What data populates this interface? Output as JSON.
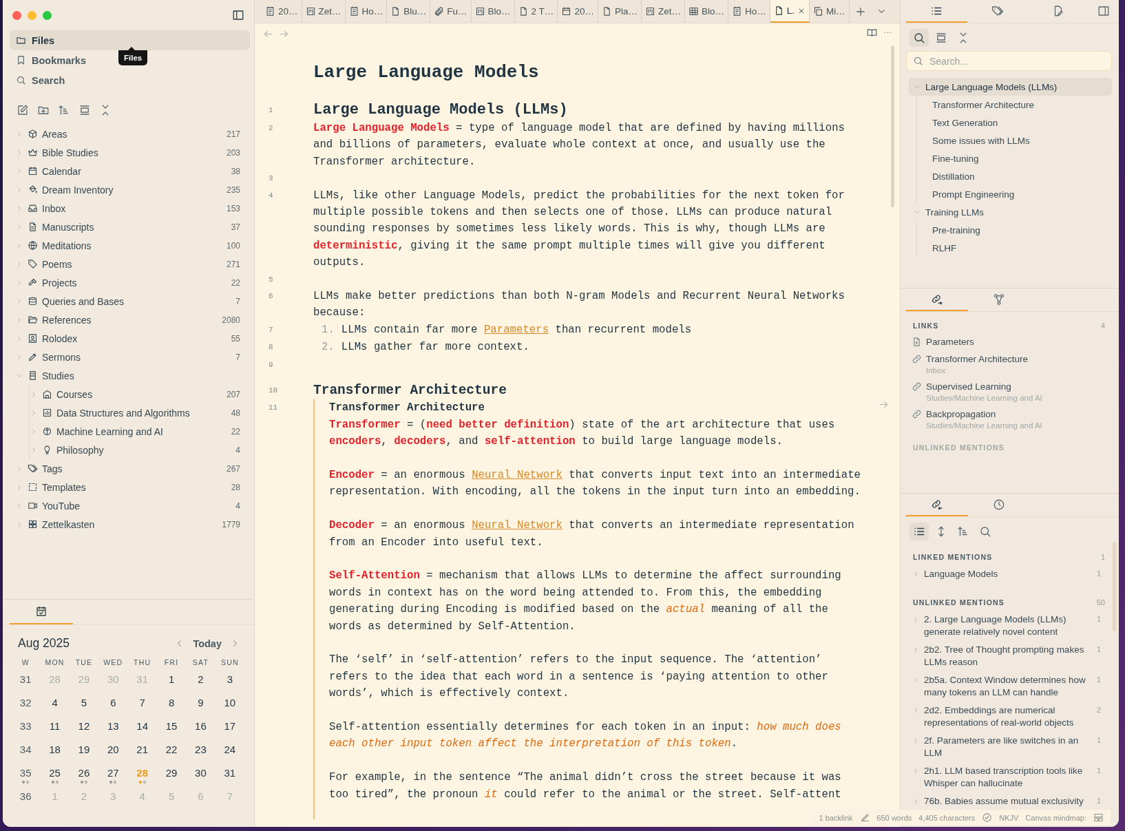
{
  "left_sidebar": {
    "nav": [
      {
        "label": "Files",
        "selected": true
      },
      {
        "label": "Bookmarks",
        "selected": false
      },
      {
        "label": "Search",
        "selected": false
      }
    ],
    "tooltip": "Files",
    "tree": [
      {
        "label": "Areas",
        "count": "217",
        "expanded": false
      },
      {
        "label": "Bible Studies",
        "count": "203",
        "expanded": false
      },
      {
        "label": "Calendar",
        "count": "38",
        "expanded": false
      },
      {
        "label": "Dream Inventory",
        "count": "235",
        "expanded": false
      },
      {
        "label": "Inbox",
        "count": "153",
        "expanded": false
      },
      {
        "label": "Manuscripts",
        "count": "37",
        "expanded": false
      },
      {
        "label": "Meditations",
        "count": "100",
        "expanded": false
      },
      {
        "label": "Poems",
        "count": "271",
        "expanded": false
      },
      {
        "label": "Projects",
        "count": "22",
        "expanded": false
      },
      {
        "label": "Queries and Bases",
        "count": "7",
        "expanded": false
      },
      {
        "label": "References",
        "count": "2080",
        "expanded": false
      },
      {
        "label": "Rolodex",
        "count": "55",
        "expanded": false
      },
      {
        "label": "Sermons",
        "count": "7",
        "expanded": false
      },
      {
        "label": "Studies",
        "expanded": true,
        "children": [
          {
            "label": "Courses",
            "count": "207",
            "expanded": false
          },
          {
            "label": "Data Structures and Algorithms",
            "count": "48",
            "expanded": false
          },
          {
            "label": "Machine Learning and AI",
            "count": "22",
            "expanded": false
          },
          {
            "label": "Philosophy",
            "count": "4",
            "expanded": false
          }
        ]
      },
      {
        "label": "Tags",
        "count": "267",
        "expanded": false
      },
      {
        "label": "Templates",
        "count": "28",
        "expanded": false
      },
      {
        "label": "YouTube",
        "count": "4",
        "expanded": false
      },
      {
        "label": "Zettelkasten",
        "count": "1779",
        "expanded": false
      }
    ],
    "calendar": {
      "month": "Aug 2025",
      "today_button": "Today",
      "weekdays": [
        "W",
        "MON",
        "TUE",
        "WED",
        "THU",
        "FRI",
        "SAT",
        "SUN"
      ],
      "weeks": [
        {
          "week": "31",
          "dots": false,
          "days": [
            {
              "label": "28",
              "outside": true,
              "today": false,
              "dots": false
            },
            {
              "label": "29",
              "outside": true,
              "today": false,
              "dots": false
            },
            {
              "label": "30",
              "outside": true,
              "today": false,
              "dots": false
            },
            {
              "label": "31",
              "outside": true,
              "today": false,
              "dots": false
            },
            {
              "label": "1",
              "outside": false,
              "today": false,
              "dots": false
            },
            {
              "label": "2",
              "outside": false,
              "today": false,
              "dots": false
            },
            {
              "label": "3",
              "outside": false,
              "today": false,
              "dots": false
            }
          ]
        },
        {
          "week": "32",
          "dots": false,
          "days": [
            {
              "label": "4",
              "outside": false,
              "today": false,
              "dots": false
            },
            {
              "label": "5",
              "outside": false,
              "today": false,
              "dots": false
            },
            {
              "label": "6",
              "outside": false,
              "today": false,
              "dots": false
            },
            {
              "label": "7",
              "outside": false,
              "today": false,
              "dots": false
            },
            {
              "label": "8",
              "outside": false,
              "today": false,
              "dots": false
            },
            {
              "label": "9",
              "outside": false,
              "today": false,
              "dots": false
            },
            {
              "label": "10",
              "outside": false,
              "today": false,
              "dots": false
            }
          ]
        },
        {
          "week": "33",
          "dots": false,
          "days": [
            {
              "label": "11",
              "outside": false,
              "today": false,
              "dots": false
            },
            {
              "label": "12",
              "outside": false,
              "today": false,
              "dots": false
            },
            {
              "label": "13",
              "outside": false,
              "today": false,
              "dots": false
            },
            {
              "label": "14",
              "outside": false,
              "today": false,
              "dots": false
            },
            {
              "label": "15",
              "outside": false,
              "today": false,
              "dots": false
            },
            {
              "label": "16",
              "outside": false,
              "today": false,
              "dots": false
            },
            {
              "label": "17",
              "outside": false,
              "today": false,
              "dots": false
            }
          ]
        },
        {
          "week": "34",
          "dots": false,
          "days": [
            {
              "label": "18",
              "outside": false,
              "today": false,
              "dots": false
            },
            {
              "label": "19",
              "outside": false,
              "today": false,
              "dots": false
            },
            {
              "label": "20",
              "outside": false,
              "today": false,
              "dots": false
            },
            {
              "label": "21",
              "outside": false,
              "today": false,
              "dots": false
            },
            {
              "label": "22",
              "outside": false,
              "today": false,
              "dots": false
            },
            {
              "label": "23",
              "outside": false,
              "today": false,
              "dots": false
            },
            {
              "label": "24",
              "outside": false,
              "today": false,
              "dots": false
            }
          ]
        },
        {
          "week": "35",
          "dots": true,
          "days": [
            {
              "label": "25",
              "outside": false,
              "today": false,
              "dots": true
            },
            {
              "label": "26",
              "outside": false,
              "today": false,
              "dots": true
            },
            {
              "label": "27",
              "outside": false,
              "today": false,
              "dots": true
            },
            {
              "label": "28",
              "outside": false,
              "today": true,
              "dots": true
            },
            {
              "label": "29",
              "outside": false,
              "today": false,
              "dots": false
            },
            {
              "label": "30",
              "outside": false,
              "today": false,
              "dots": false
            },
            {
              "label": "31",
              "outside": false,
              "today": false,
              "dots": false
            }
          ]
        },
        {
          "week": "36",
          "dots": false,
          "days": [
            {
              "label": "1",
              "outside": true,
              "today": false,
              "dots": false
            },
            {
              "label": "2",
              "outside": true,
              "today": false,
              "dots": false
            },
            {
              "label": "3",
              "outside": true,
              "today": false,
              "dots": false
            },
            {
              "label": "4",
              "outside": true,
              "today": false,
              "dots": false
            },
            {
              "label": "5",
              "outside": true,
              "today": false,
              "dots": false
            },
            {
              "label": "6",
              "outside": true,
              "today": false,
              "dots": false
            },
            {
              "label": "7",
              "outside": true,
              "today": false,
              "dots": false
            }
          ]
        }
      ]
    }
  },
  "editor": {
    "tabs": [
      {
        "label": "20…",
        "selected": false
      },
      {
        "label": "Zet…",
        "selected": false
      },
      {
        "label": "Ho…",
        "selected": false
      },
      {
        "label": "Blu…",
        "selected": false
      },
      {
        "label": "Fu…",
        "selected": false
      },
      {
        "label": "Blo…",
        "selected": false
      },
      {
        "label": "2 T…",
        "selected": false
      },
      {
        "label": "20…",
        "selected": false
      },
      {
        "label": "Pla…",
        "selected": false
      },
      {
        "label": "Zet…",
        "selected": false
      },
      {
        "label": "Blo…",
        "selected": false
      },
      {
        "label": "Ho…",
        "selected": false
      },
      {
        "label": "L.",
        "selected": true
      },
      {
        "label": "Mi…",
        "selected": false
      }
    ],
    "title": "Large Language Models",
    "blocks": [
      {
        "kind": "h1",
        "line": "1",
        "segments": [
          {
            "text": "Large Language Models (LLMs)",
            "kind": "plain"
          }
        ]
      },
      {
        "kind": "para",
        "line": "2",
        "segments": [
          {
            "text": "Large Language Models",
            "kind": "term"
          },
          {
            "text": " = type of language model that are defined by having millions and billions of parameters, evaluate whole context at once, and usually use the Transformer architecture.",
            "kind": "plain"
          }
        ]
      },
      {
        "kind": "blank",
        "line": "3"
      },
      {
        "kind": "para",
        "line": "4",
        "segments": [
          {
            "text": "LLMs, like other Language Models, predict the probabilities for the next token for multiple possible tokens and then selects one of those. LLMs can produce natural sounding responses by sometimes less likely words. This is why, though LLMs are ",
            "kind": "plain"
          },
          {
            "text": "deterministic",
            "kind": "term"
          },
          {
            "text": ", giving it the same prompt multiple times will give you different outputs.",
            "kind": "plain"
          }
        ]
      },
      {
        "kind": "blank",
        "line": "5"
      },
      {
        "kind": "para",
        "line": "6",
        "segments": [
          {
            "text": "LLMs make better predictions than both N-gram Models and Recurrent Neural Networks because:",
            "kind": "plain"
          }
        ]
      },
      {
        "kind": "item",
        "line": "7",
        "marker": "1.",
        "segments": [
          {
            "text": "LLMs contain far more ",
            "kind": "plain"
          },
          {
            "text": "Parameters",
            "kind": "link"
          },
          {
            "text": " than recurrent models",
            "kind": "plain"
          }
        ]
      },
      {
        "kind": "item",
        "line": "8",
        "marker": "2.",
        "segments": [
          {
            "text": "LLMs gather far more context.",
            "kind": "plain"
          }
        ]
      },
      {
        "kind": "blank",
        "line": "9"
      },
      {
        "kind": "h2",
        "line": "10",
        "segments": [
          {
            "text": "Transformer Architecture",
            "kind": "plain"
          }
        ]
      },
      {
        "kind": "embed",
        "line": "11",
        "title": "Transformer Architecture",
        "paragraphs": [
          [
            {
              "text": "Transformer",
              "kind": "term"
            },
            {
              "text": " = (",
              "kind": "plain"
            },
            {
              "text": "need better definition",
              "kind": "term"
            },
            {
              "text": ") state of the art architecture that uses ",
              "kind": "plain"
            },
            {
              "text": "encoders",
              "kind": "term"
            },
            {
              "text": ", ",
              "kind": "plain"
            },
            {
              "text": "decoders",
              "kind": "term"
            },
            {
              "text": ", and ",
              "kind": "plain"
            },
            {
              "text": "self-attention",
              "kind": "term"
            },
            {
              "text": " to build large language models.",
              "kind": "plain"
            }
          ],
          [
            {
              "text": "Encoder",
              "kind": "term"
            },
            {
              "text": " = an enormous ",
              "kind": "plain"
            },
            {
              "text": "Neural Network",
              "kind": "link"
            },
            {
              "text": " that converts input text into an intermediate representation. With encoding, all the tokens in the input turn into an embedding.",
              "kind": "plain"
            }
          ],
          [
            {
              "text": "Decoder",
              "kind": "term"
            },
            {
              "text": " = an enormous ",
              "kind": "plain"
            },
            {
              "text": "Neural Network",
              "kind": "link"
            },
            {
              "text": " that converts an intermediate representation from an Encoder into useful text.",
              "kind": "plain"
            }
          ],
          [
            {
              "text": "Self-Attention",
              "kind": "term"
            },
            {
              "text": " = mechanism that allows LLMs to determine the affect surrounding words in context has on the word being attended to. From this, the embedding generating during Encoding is modified based on the ",
              "kind": "plain"
            },
            {
              "text": "actual",
              "kind": "emph"
            },
            {
              "text": " meaning of all the words as determined by Self-Attention.",
              "kind": "plain"
            }
          ],
          [
            {
              "text": "The ‘self’ in ‘self-attention’ refers to the input sequence. The ‘attention’ refers to the idea that each word in a sentence is ‘paying attention to other words’, which is effectively context.",
              "kind": "plain"
            }
          ],
          [
            {
              "text": "Self-attention essentially determines for each token in an input: ",
              "kind": "plain"
            },
            {
              "text": "how much does each other input token affect the interpretation of this token",
              "kind": "emph"
            },
            {
              "text": ".",
              "kind": "plain"
            }
          ],
          [
            {
              "text": "For example, in the sentence “The animal didn’t cross the street because it was too tired”, the pronoun ",
              "kind": "plain"
            },
            {
              "text": "it",
              "kind": "emph"
            },
            {
              "text": " could refer to the animal or the street. Self-attent",
              "kind": "plain"
            }
          ]
        ]
      }
    ],
    "status_bar": {
      "backlinks": "1 backlink",
      "words": "650 words",
      "characters": "4,405 characters",
      "translation": "NKJV",
      "canvas": "Canvas mindmap:"
    }
  },
  "right_sidebar": {
    "tabs": [
      {
        "selected": true
      },
      {
        "selected": false
      },
      {
        "selected": false
      }
    ],
    "outline": {
      "tools": [
        {
          "selected": true
        },
        {
          "selected": false
        },
        {
          "selected": false
        }
      ],
      "search_placeholder": "Search...",
      "headings": [
        {
          "label": "Large Language Models (LLMs)",
          "selected": true,
          "expanded": true,
          "children": [
            {
              "label": "Transformer Architecture",
              "selected": false
            },
            {
              "label": "Text Generation",
              "selected": false
            },
            {
              "label": "Some issues with LLMs",
              "selected": false
            },
            {
              "label": "Fine-tuning",
              "selected": false
            },
            {
              "label": "Distillation",
              "selected": false
            },
            {
              "label": "Prompt Engineering",
              "selected": false
            }
          ]
        },
        {
          "label": "Training LLMs",
          "selected": false,
          "expanded": true,
          "children": [
            {
              "label": "Pre-training",
              "selected": false
            },
            {
              "label": "RLHF",
              "selected": false
            }
          ]
        }
      ]
    },
    "links_pane": {
      "tabs": [
        {
          "selected": true
        },
        {
          "selected": false
        }
      ],
      "links_heading": "LINKS",
      "links_count": "4",
      "links": [
        {
          "title": "Parameters",
          "kind": "file"
        },
        {
          "title": "Transformer Architecture",
          "path": "Inbox",
          "kind": "link"
        },
        {
          "title": "Supervised Learning",
          "path": "Studies/Machine Learning and AI",
          "kind": "link"
        },
        {
          "title": "Backpropagation",
          "path": "Studies/Machine Learning and AI",
          "kind": "link"
        }
      ],
      "unlinked_heading": "UNLINKED MENTIONS"
    },
    "backlinks_pane": {
      "tabs": [
        {
          "selected": true
        },
        {
          "selected": false
        }
      ],
      "tools": [
        {
          "selected": true
        },
        {
          "selected": false
        },
        {
          "selected": false
        },
        {
          "selected": false
        }
      ],
      "linked_heading": "LINKED MENTIONS",
      "linked_count": "1",
      "linked": [
        {
          "title": "Language Models",
          "count": "1"
        }
      ],
      "unlinked_heading": "UNLINKED MENTIONS",
      "unlinked_count": "50",
      "unlinked": [
        {
          "title": "2. Large Language Models (LLMs) generate relatively novel content",
          "count": "1"
        },
        {
          "title": "2b2. Tree of Thought prompting makes LLMs reason",
          "count": "1"
        },
        {
          "title": "2b5a. Context Window determines how many tokens an LLM can handle",
          "count": "1"
        },
        {
          "title": "2d2. Embeddings are numerical representations of real-world objects",
          "count": "2"
        },
        {
          "title": "2f. Parameters are like switches in an LLM",
          "count": "1"
        },
        {
          "title": "2h1. LLM based transcription tools like Whisper can hallucinate",
          "count": "1"
        },
        {
          "title": "76b. Babies assume mutual exclusivity",
          "count": "1"
        }
      ]
    }
  }
}
